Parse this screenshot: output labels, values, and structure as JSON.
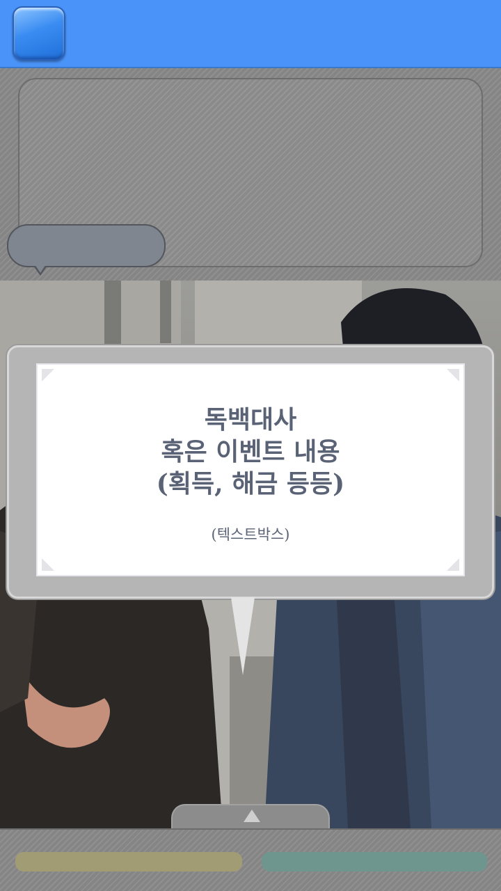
{
  "top_bar": {
    "menu_icon": "menu-square-icon",
    "color": "#4a94f9"
  },
  "chat": {
    "message": "",
    "speaker_name": ""
  },
  "monologue": {
    "text": "독백대사\n혹은 이벤트 내용\n(획득, 해금 등등)",
    "caption": "(텍스트박스)"
  },
  "controls": {
    "next_icon": "up-triangle-icon",
    "choice_left_color": "#a29c74",
    "choice_right_color": "#6f958f"
  }
}
